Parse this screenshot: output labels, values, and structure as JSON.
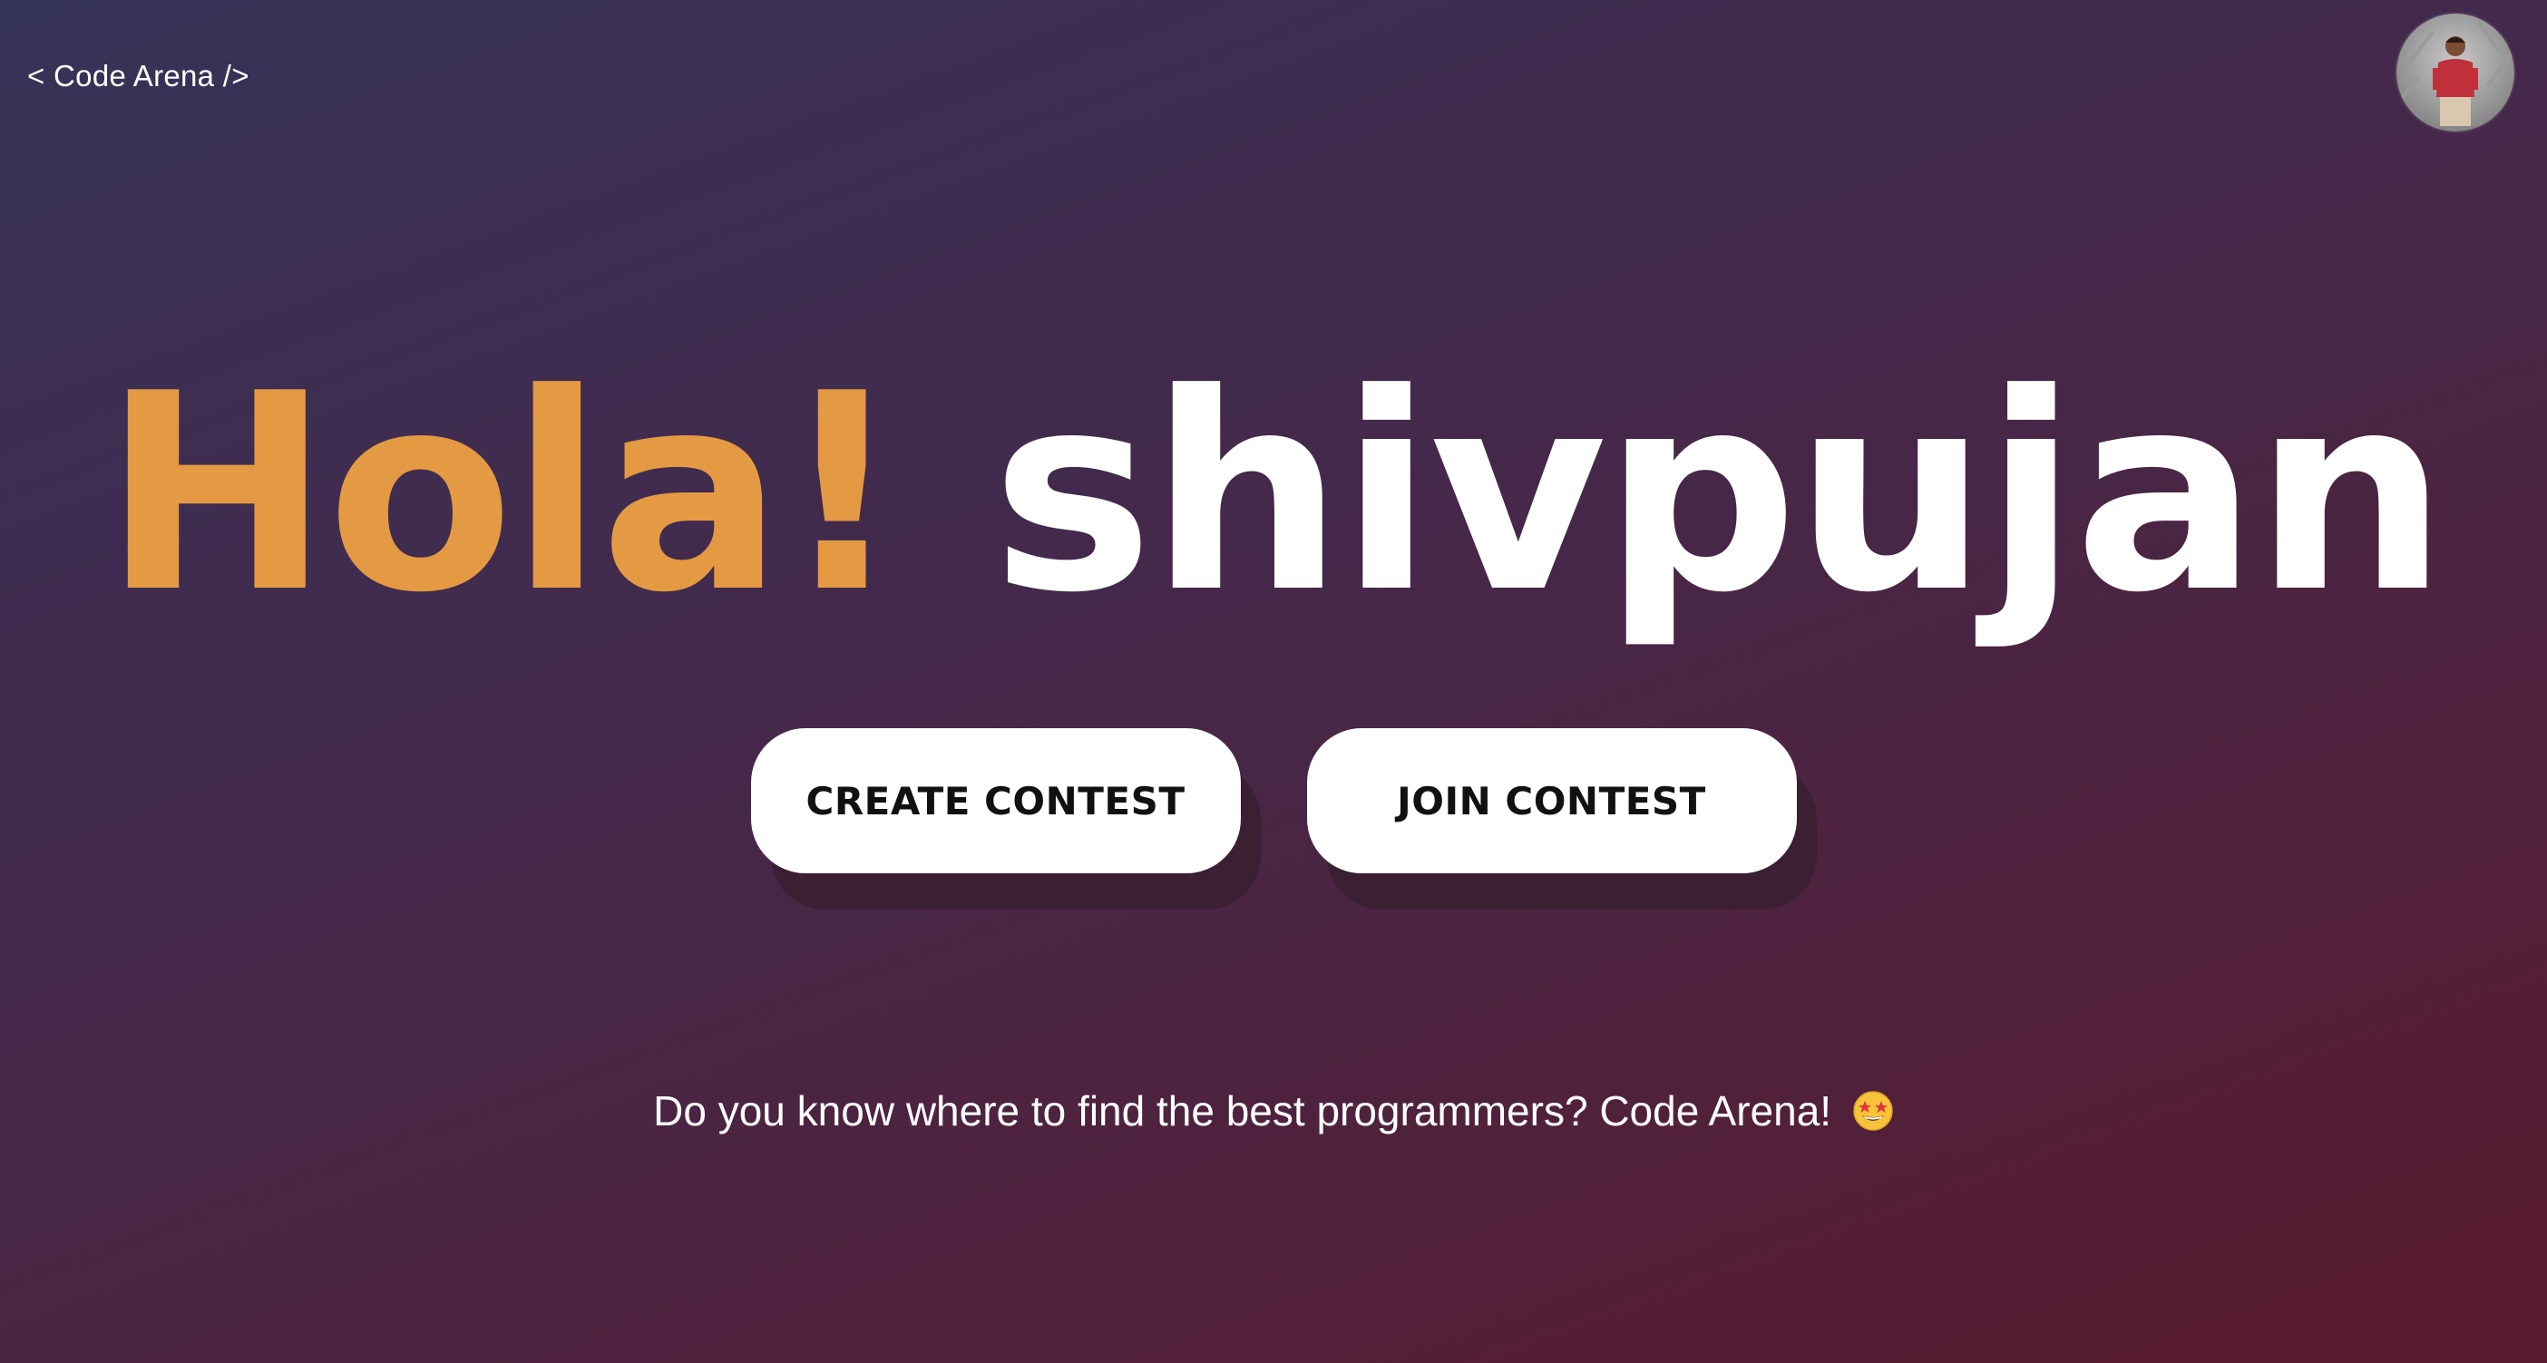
{
  "header": {
    "logo_text": "< Code Arena />"
  },
  "avatar": {
    "icon": "user-avatar"
  },
  "hero": {
    "greeting": "Hola!",
    "username": "shivpujan"
  },
  "actions": {
    "create_label": "CREATE CONTEST",
    "join_label": "JOIN CONTEST"
  },
  "tagline": {
    "text": "Do you know where to find the best programmers? Code Arena!",
    "emoji_icon": "star-struck-emoji"
  },
  "colors": {
    "accent": "#e39a42",
    "background_start": "#363358",
    "background_end": "#5a1b2e",
    "button_bg": "#ffffff",
    "button_text": "#111111"
  }
}
